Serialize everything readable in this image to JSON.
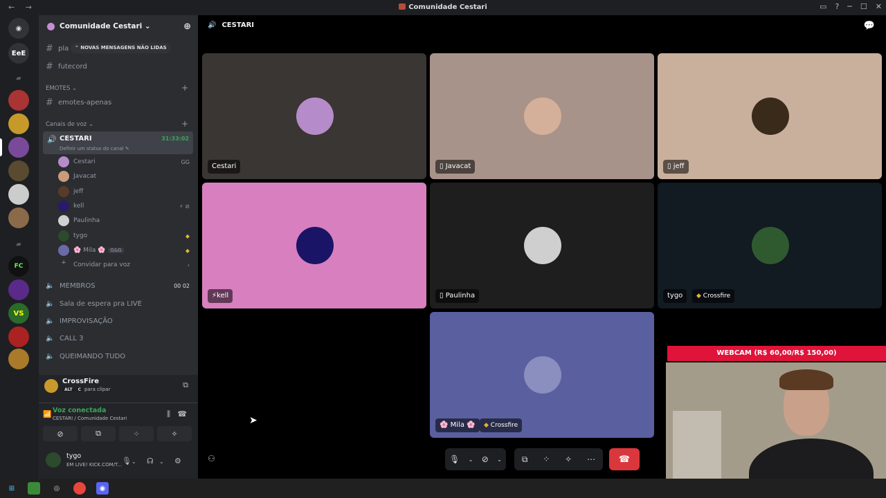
{
  "window": {
    "title": "Comunidade Cestari",
    "nav": "← →"
  },
  "server": {
    "name": "Comunidade Cestari ⌄",
    "new_messages_pill": "⌃ NOVAS MENSAGENS NÃO LIDAS"
  },
  "channels": {
    "text": [
      {
        "name": "pla"
      },
      {
        "name": "futecord"
      }
    ],
    "emotes_category": "EMOTES ⌄",
    "emotes_channel": "emotes-apenas",
    "voice_category": "Canais de voz ⌄",
    "active_voice": {
      "name": "CESTARI",
      "time": "31:33:02",
      "status": "Definir um status do canal ✎"
    },
    "voice_users": [
      {
        "name": "Cestari",
        "badge": "GG",
        "color": "#b58cc9"
      },
      {
        "name": "Javacat",
        "badge": "",
        "color": "#c99c7a"
      },
      {
        "name": "jeff",
        "badge": "",
        "color": "#5a3a2a"
      },
      {
        "name": "kell",
        "badge": "⚡ ⊘",
        "color": "#2a1a6a"
      },
      {
        "name": "Paulinha",
        "badge": "",
        "color": "#d0d0d0"
      },
      {
        "name": "tygo",
        "badge": "◆",
        "color": "#2d4a2d"
      },
      {
        "name": "🌸 Mila 🌸",
        "extra": "G&G",
        "badge": "◆",
        "color": "#6a6aa8"
      }
    ],
    "invite": "Convidar para voz",
    "other_voice": [
      {
        "name": "MEMBROS",
        "count": "00  02"
      },
      {
        "name": "Sala de espera pra LIVE",
        "count": ""
      },
      {
        "name": "IMPROVISAÇÃO",
        "count": ""
      },
      {
        "name": "CALL 3",
        "count": ""
      },
      {
        "name": "QUEIMANDO TUDO",
        "count": ""
      }
    ]
  },
  "panel": {
    "game": "CrossFire",
    "shortcut_keys": [
      "ALT",
      "C"
    ],
    "shortcut_label": "para clipar",
    "voice_status": "Voz conectada",
    "voice_location": "CESTARI / Comunidade Cestari",
    "user_name": "tygo",
    "user_status": "EM LIVE! KICK.COM/T..."
  },
  "main": {
    "channel": "CESTARI",
    "tiles": [
      {
        "name": "Cestari",
        "bg": "#3a3634",
        "av": "#b58cc9",
        "mobile": false,
        "game": ""
      },
      {
        "name": "Javacat",
        "bg": "#a8938a",
        "av": "#d4b09a",
        "mobile": true,
        "game": ""
      },
      {
        "name": "jeff",
        "bg": "#c9b09c",
        "av": "#3a2a1a",
        "mobile": true,
        "game": ""
      },
      {
        "name": "kell",
        "bg": "#d87fbf",
        "av": "#1a1466",
        "mobile": false,
        "game": "",
        "prefix": "⚡"
      },
      {
        "name": "Paulinha",
        "bg": "#1e1e1e",
        "av": "#cfcfcf",
        "mobile": true,
        "game": ""
      },
      {
        "name": "tygo",
        "bg": "#121a22",
        "av": "#2f5a2f",
        "mobile": false,
        "game": "Crossfire"
      },
      {
        "name": "🌸 Mila 🌸",
        "bg": "#5a5fa0",
        "av": "#8a8fc0",
        "mobile": false,
        "game": "Crossfire"
      }
    ]
  },
  "webcam": {
    "banner": "WEBCAM (R$ 60,00/R$ 150,00)"
  },
  "colors": {
    "accent": "#3ba55d",
    "danger": "#da373c",
    "brand": "#5865f2"
  }
}
